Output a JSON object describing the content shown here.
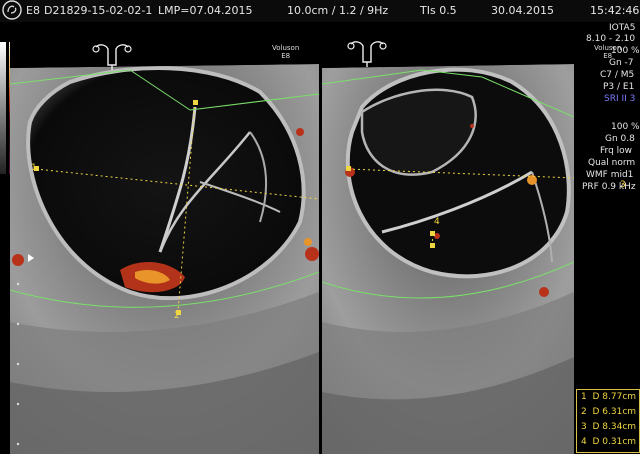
{
  "header": {
    "exam_id": "D21829-15-02-02-1",
    "lmp": "LMP=07.04.2015",
    "depth_info": "10.0cm / 1.2 / 9Hz",
    "tis": "TIs  0.5",
    "date": "30.04.2015",
    "time": "15:42:46",
    "logo_sub": "E8"
  },
  "panels": {
    "left_probe": {
      "name": "Voluson",
      "model": "E8"
    },
    "right_probe": {
      "name": "Voluson",
      "model": "E8"
    }
  },
  "settings": {
    "preset": "IOTA5",
    "freq": "8.10 - 2.10",
    "power": "100 %",
    "gain": "Gn  -7",
    "map": "C7 / M5",
    "persist": "P3 / E1",
    "sri": "SRI II 3",
    "cfm_power": "100 %",
    "cfm_gain": "Gn  0.8",
    "frq": "Frq low",
    "quality": "Qual norm",
    "wmf": "WMF mid1",
    "prf": "PRF  0.9 kHz"
  },
  "markers": {
    "m1": "1",
    "m2": "2",
    "m3": "3",
    "m4": "4"
  },
  "measurements": [
    {
      "idx": "1",
      "label": "D",
      "value": "8.77cm"
    },
    {
      "idx": "2",
      "label": "D",
      "value": "6.31cm"
    },
    {
      "idx": "3",
      "label": "D",
      "value": "8.34cm"
    },
    {
      "idx": "4",
      "label": "D",
      "value": "0.31cm"
    }
  ],
  "colors": {
    "caliper": "#f0d640",
    "roi": "#7be06a",
    "doppler_red": "#c4361c",
    "doppler_orange": "#e8942a",
    "header_text": "#e6e6e6"
  }
}
